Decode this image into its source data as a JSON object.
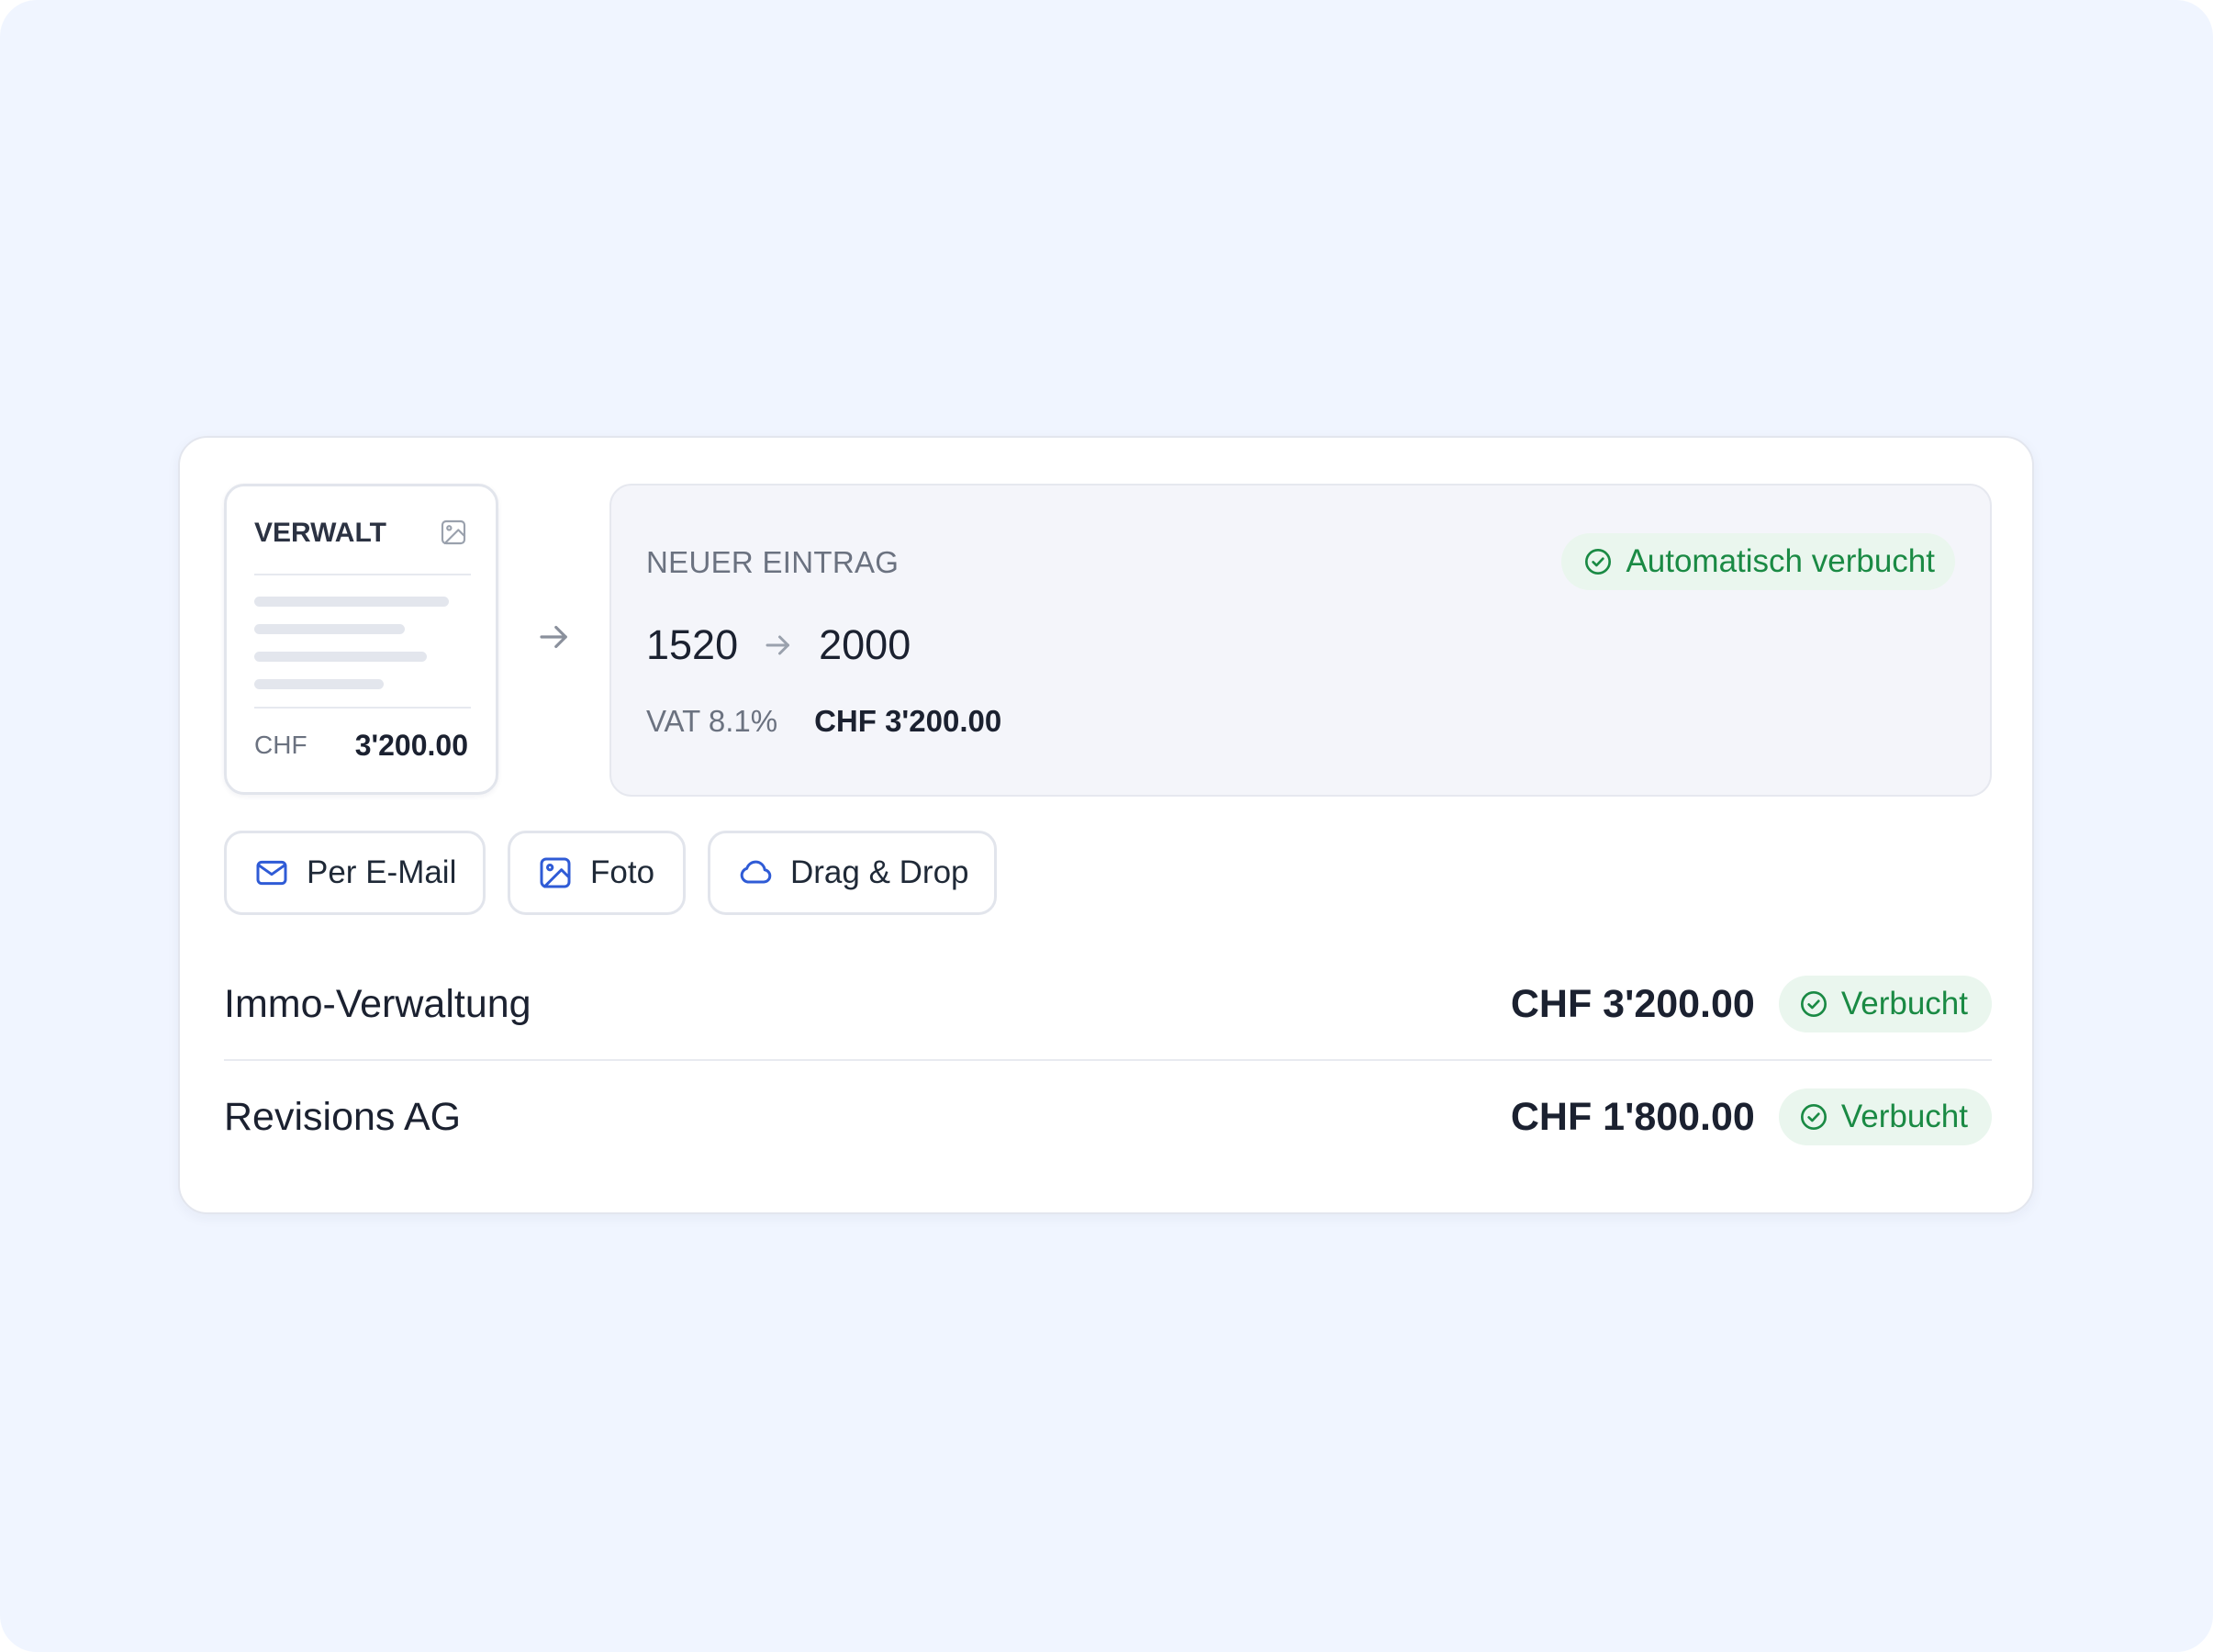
{
  "receipt": {
    "title": "VERWALT",
    "currency": "CHF",
    "amount": "3'200.00"
  },
  "entry": {
    "label": "NEUER EINTRAG",
    "status": "Automatisch verbucht",
    "from_account": "1520",
    "to_account": "2000",
    "vat_label": "VAT 8.1%",
    "vat_amount": "CHF 3'200.00"
  },
  "upload_methods": [
    {
      "label": "Per E-Mail",
      "icon": "mail-icon"
    },
    {
      "label": "Foto",
      "icon": "image-icon"
    },
    {
      "label": "Drag & Drop",
      "icon": "cloud-icon"
    }
  ],
  "ledger": [
    {
      "name": "Immo-Verwaltung",
      "amount": "CHF 3'200.00",
      "status": "Verbucht"
    },
    {
      "name": "Revisions AG",
      "amount": "CHF 1'800.00",
      "status": "Verbucht"
    }
  ],
  "colors": {
    "background": "#f0f5ff",
    "accent_blue": "#2f5bd6",
    "success_green": "#1a8a44",
    "success_bg": "#eaf6ee"
  }
}
